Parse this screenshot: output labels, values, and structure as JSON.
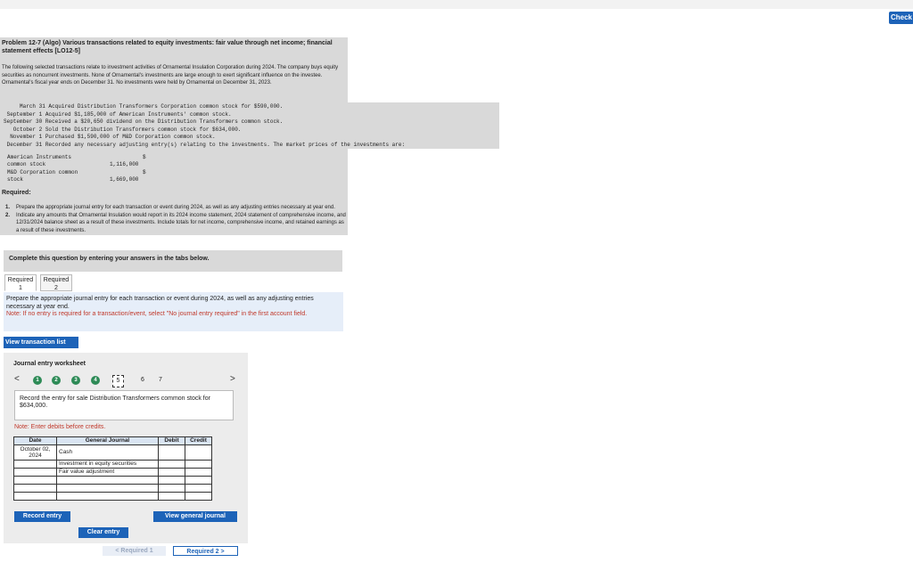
{
  "top": {
    "check_label": "Check"
  },
  "problem": {
    "title": "Problem 12-7 (Algo) Various transactions related to equity investments: fair value through net income; financial statement effects [LO12-5]",
    "intro": "The following selected transactions relate to investment activities of Ornamental Insulation Corporation during 2024. The company buys equity securities as noncurrent investments. None of Ornamental's investments are large enough to exert significant influence on the investee. Ornamental's fiscal year ends on December 31. No investments were held by Ornamental on December 31, 2023.",
    "transactions": [
      {
        "date": "     March 31",
        "text": " Acquired Distribution Transformers Corporation common stock for $590,000."
      },
      {
        "date": " September 1",
        "text": " Acquired $1,185,000 of American Instruments' common stock."
      },
      {
        "date": "September 30",
        "text": " Received a $20,650 dividend on the Distribution Transformers common stock."
      },
      {
        "date": "   October 2",
        "text": " Sold the Distribution Transformers common stock for $634,000."
      },
      {
        "date": "  November 1",
        "text": " Purchased $1,590,000 of M&D Corporation common stock."
      },
      {
        "date": " December 31",
        "text": " Recorded any necessary adjusting entry(s) relating to the investments. The market prices of the investments are:"
      }
    ],
    "prices": {
      "ai_label_1": "American Instruments",
      "ai_label_2": "common stock",
      "ai_dollar": "$",
      "ai_value": "1,116,000",
      "md_label_1": "M&D Corporation common",
      "md_label_2": "stock",
      "md_dollar": "$",
      "md_value": "1,669,000"
    },
    "required_heading": "Required:",
    "required": [
      {
        "num": "1.",
        "text": "Prepare the appropriate journal entry for each transaction or event during 2024, as well as any adjusting entries necessary at year end."
      },
      {
        "num": "2.",
        "text": "Indicate any amounts that Ornamental Insulation would report in its 2024 income statement, 2024 statement of comprehensive income, and 12/31/2024 balance sheet as a result of these investments. Include totals for net income, comprehensive income, and retained earnings as a result of these investments."
      }
    ]
  },
  "complete_text": "Complete this question by entering your answers in the tabs below.",
  "tabs": [
    {
      "line1": "Required",
      "line2": "1"
    },
    {
      "line1": "Required",
      "line2": "2"
    }
  ],
  "instructions": {
    "text": "Prepare the appropriate journal entry for each transaction or event during 2024, as well as any adjusting entries necessary at year end.",
    "note": "Note: If no entry is required for a transaction/event, select \"No journal entry required\" in the first account field."
  },
  "view_transaction_list": "View transaction list",
  "worksheet": {
    "title": "Journal entry worksheet",
    "prev": "<",
    "next": ">",
    "steps": [
      "1",
      "2",
      "3",
      "4"
    ],
    "current_step": "5",
    "later_steps": [
      "6",
      "7"
    ],
    "entry_text": "Record the entry for sale Distribution Transformers common stock for $634,000.",
    "note": "Note: Enter debits before credits.",
    "headers": {
      "date": "Date",
      "account": "General Journal",
      "debit": "Debit",
      "credit": "Credit"
    },
    "rows": [
      {
        "date": "October 02, 2024",
        "account": "Cash"
      },
      {
        "date": "",
        "account": "Investment in equity securities"
      },
      {
        "date": "",
        "account": "Fair value adjustment"
      },
      {
        "date": "",
        "account": ""
      },
      {
        "date": "",
        "account": ""
      },
      {
        "date": "",
        "account": ""
      }
    ],
    "record_entry": "Record entry",
    "clear_entry": "Clear entry",
    "view_general_journal": "View general journal"
  },
  "nav": {
    "prev": "< Required 1",
    "next": "Required 2 >"
  },
  "colors": {
    "accent": "#1d63b8",
    "grey_panel": "#d9d9d9",
    "blue_panel": "#e6eef9",
    "green_step": "#2e8b57",
    "note_red": "#c0392b"
  }
}
